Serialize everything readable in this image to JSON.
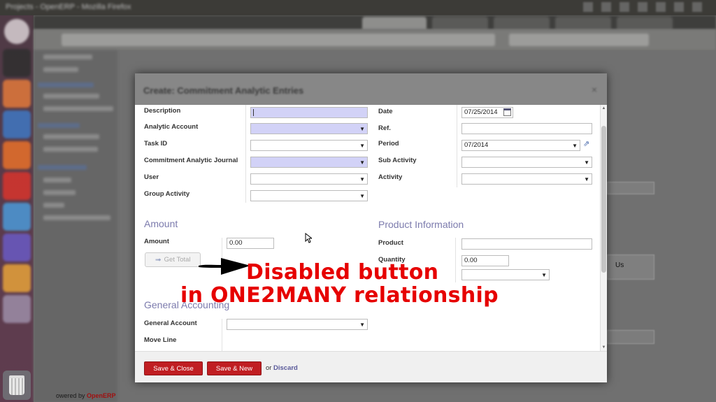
{
  "topbar": {
    "title": "Projects - OpenERP - Mozilla Firefox"
  },
  "modal": {
    "title": "Create: Commitment Analytic Entries",
    "fields_left": [
      {
        "label": "Description",
        "value": "",
        "required": true,
        "type": "text"
      },
      {
        "label": "Analytic Account",
        "value": "",
        "required": true,
        "type": "select"
      },
      {
        "label": "Task ID",
        "value": "",
        "required": false,
        "type": "select"
      },
      {
        "label": "Commitment Analytic Journal",
        "value": "",
        "required": true,
        "type": "select"
      },
      {
        "label": "User",
        "value": "",
        "required": false,
        "type": "select"
      },
      {
        "label": "Group Activity",
        "value": "",
        "required": false,
        "type": "select"
      }
    ],
    "fields_right": [
      {
        "label": "Date",
        "value": "07/25/2014",
        "type": "date"
      },
      {
        "label": "Ref.",
        "value": "",
        "type": "text"
      },
      {
        "label": "Period",
        "value": "07/2014",
        "type": "select"
      },
      {
        "label": "Sub Activity",
        "value": "",
        "type": "select"
      },
      {
        "label": "Activity",
        "value": "",
        "type": "select"
      }
    ],
    "amount_section": {
      "title": "Amount",
      "amount_label": "Amount",
      "amount_value": "0.00",
      "get_total_label": "Get Total"
    },
    "product_section": {
      "title": "Product Information",
      "product_label": "Product",
      "product_value": "",
      "quantity_label": "Quantity",
      "quantity_value": "0.00",
      "uom_value": ""
    },
    "general_section": {
      "title": "General Accounting",
      "general_account_label": "General Account",
      "general_account_value": "",
      "move_line_label": "Move Line"
    },
    "footer": {
      "save_close_label": "Save & Close",
      "save_new_label": "Save & New",
      "or_label": "or",
      "discard_label": "Discard"
    }
  },
  "background": {
    "powered_prefix": "owered by",
    "powered_brand": "OpenERP",
    "ghost_text": "Us"
  },
  "annotation": {
    "line1": "Disabled button",
    "line2": "in ONE2MANY relationship",
    "color": "#e60000"
  }
}
